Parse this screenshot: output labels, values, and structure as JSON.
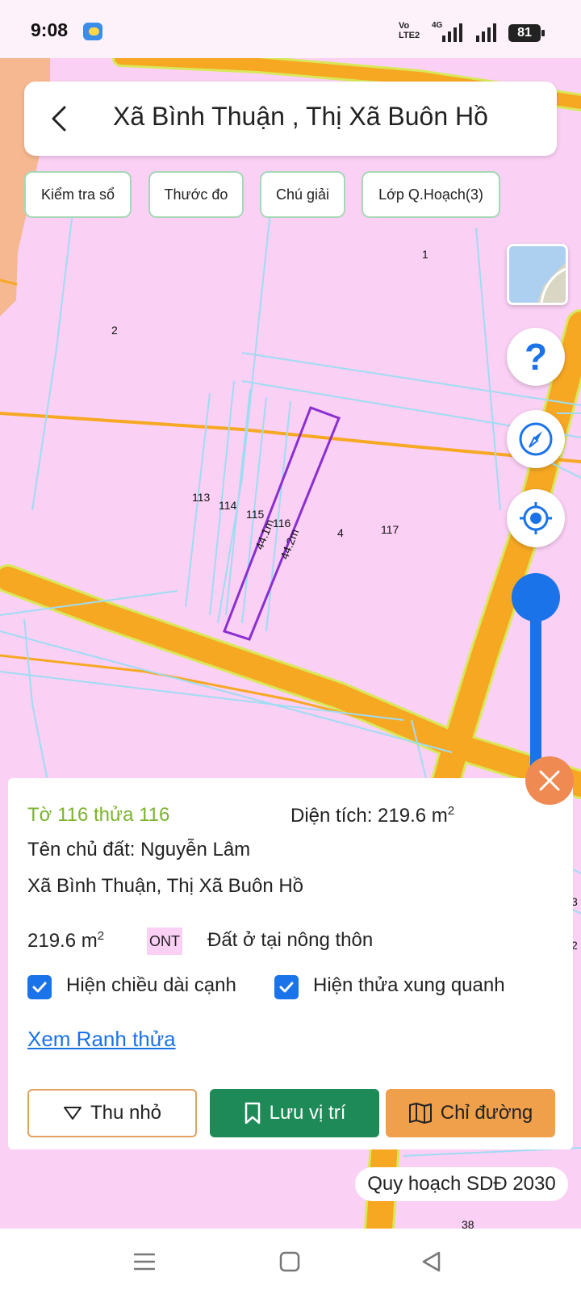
{
  "status_bar": {
    "time": "9:08",
    "volte": "Vo\nLTE2",
    "network": "4G",
    "battery": "81",
    "weather_icon": "weather-cloud-sun-icon"
  },
  "header": {
    "back_icon": "chevron-left-icon",
    "title": "Xã Bình Thuận , Thị Xã Buôn Hồ"
  },
  "toolbar": {
    "check_book": "Kiểm tra sổ",
    "ruler": "Thước đo",
    "legend": "Chú giải",
    "planning_layers": "Lớp Q.Hoạch(3)"
  },
  "map": {
    "parcel_labels": [
      "1",
      "2",
      "113",
      "114",
      "115",
      "116",
      "4",
      "117"
    ],
    "edge_lengths": [
      "44.1m",
      "44.2m"
    ],
    "colors": {
      "land_residential": "#fbd0f5",
      "road": "#f7a823",
      "road_edge": "#d9e85a",
      "parcel_boundary": "#9fdcf2",
      "selected_parcel": "#8a2fd0",
      "left_strip": "#f6b890"
    }
  },
  "side_controls": {
    "basemap_icon": "satellite-basemap-icon",
    "help_icon": "question-icon",
    "compass_icon": "compass-icon",
    "locate_icon": "crosshair-locate-icon"
  },
  "panel": {
    "sheet_parcel": "Tờ 116 thửa 116",
    "area_label": "Diện tích: 219.6 m",
    "area_sup": "2",
    "owner": "Tên chủ đất: Nguyễn Lâm",
    "address": "Xã Bình Thuận, Thị Xã Buôn Hồ",
    "area_value": "219.6 m",
    "area_value_sup": "2",
    "land_code": "ONT",
    "land_type": "Đất ở tại nông thôn",
    "show_edge_lengths": "Hiện chiều dài cạnh",
    "show_neighbors": "Hiện thửa xung quanh",
    "view_boundary_link": "Xem Ranh thửa",
    "collapse_btn": "Thu nhỏ",
    "save_btn": "Lưu vị trí",
    "route_btn": "Chỉ đường",
    "close_icon": "close-icon"
  },
  "plan_badge": "Quy hoạch SDĐ 2030",
  "right_edge_numbers": [
    "3",
    "2"
  ],
  "bottom_edge_number": "38",
  "nav_bar": {
    "menu_icon": "menu-icon",
    "home_icon": "home-square-icon",
    "back_icon": "back-triangle-icon"
  }
}
